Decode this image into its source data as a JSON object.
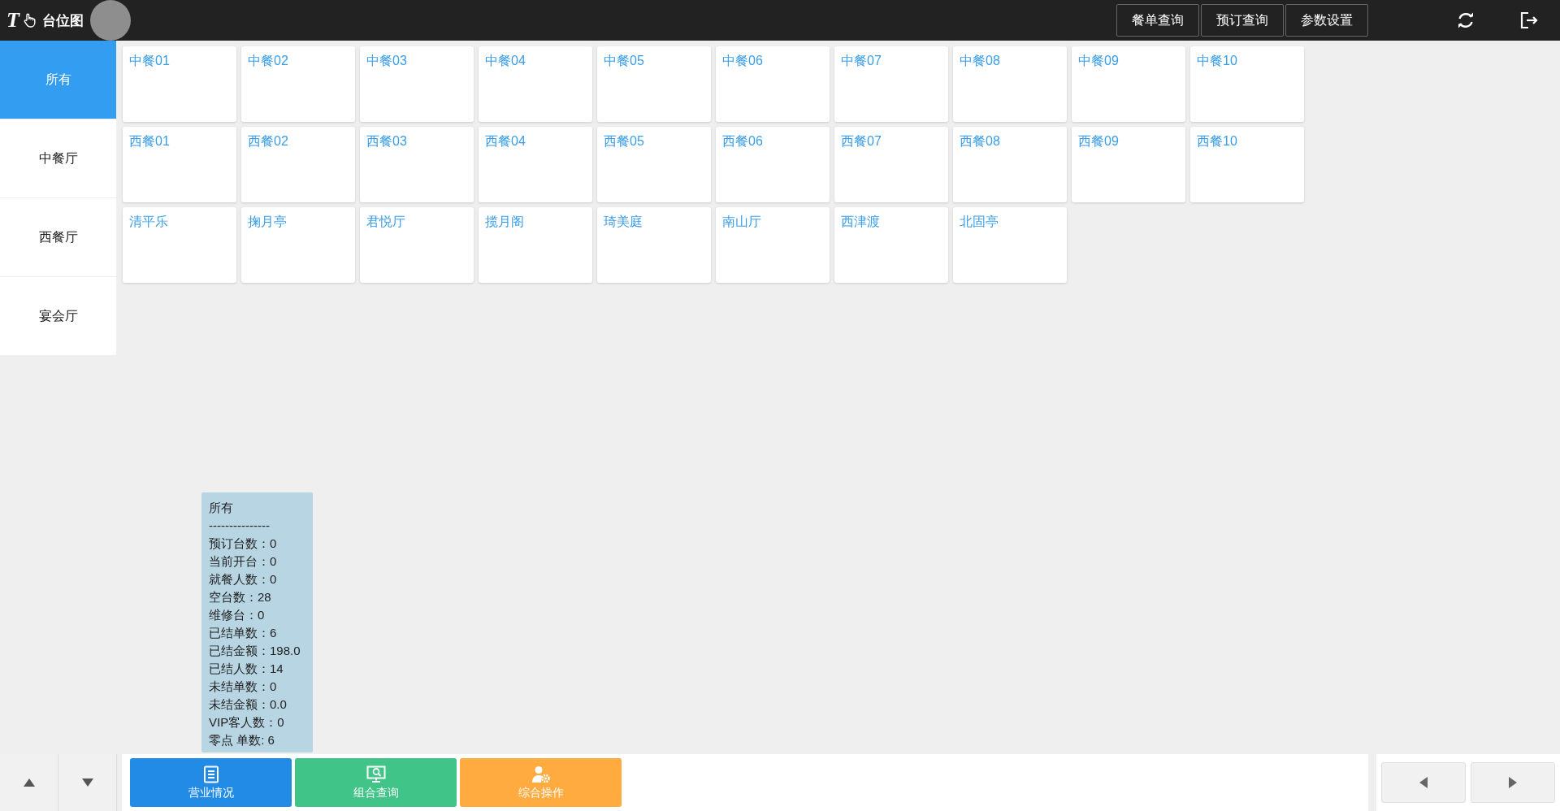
{
  "header": {
    "logo_mark": "T",
    "title": "台位图",
    "buttons": [
      "餐单查询",
      "预订查询",
      "参数设置"
    ]
  },
  "sidebar": {
    "items": [
      {
        "label": "所有",
        "selected": true
      },
      {
        "label": "中餐厅",
        "selected": false
      },
      {
        "label": "西餐厅",
        "selected": false
      },
      {
        "label": "宴会厅",
        "selected": false
      }
    ]
  },
  "tables": [
    [
      "中餐01",
      "中餐02",
      "中餐03",
      "中餐04",
      "中餐05",
      "中餐06",
      "中餐07",
      "中餐08",
      "中餐09",
      "中餐10"
    ],
    [
      "西餐01",
      "西餐02",
      "西餐03",
      "西餐04",
      "西餐05",
      "西餐06",
      "西餐07",
      "西餐08",
      "西餐09",
      "西餐10"
    ],
    [
      "清平乐",
      "掬月亭",
      "君悦厅",
      "揽月阁",
      "琦美庭",
      "南山厅",
      "西津渡",
      "北固亭"
    ]
  ],
  "summary": {
    "title": "所有",
    "separator": "---------------",
    "lines": [
      "预订台数：0",
      "当前开台：0",
      "就餐人数：0",
      "空台数：28",
      "维修台：0",
      "已结单数：6",
      "已结金额：198.0",
      "已结人数：14",
      "未结单数：0",
      "未结金额：0.0",
      "VIP客人数：0",
      "零点 单数: 6"
    ]
  },
  "actions": [
    {
      "label": "营业情况",
      "kind": "report",
      "color": "#228be6"
    },
    {
      "label": "组合查询",
      "kind": "query",
      "color": "#40c487"
    },
    {
      "label": "综合操作",
      "kind": "operate",
      "color": "#ffab40"
    }
  ]
}
